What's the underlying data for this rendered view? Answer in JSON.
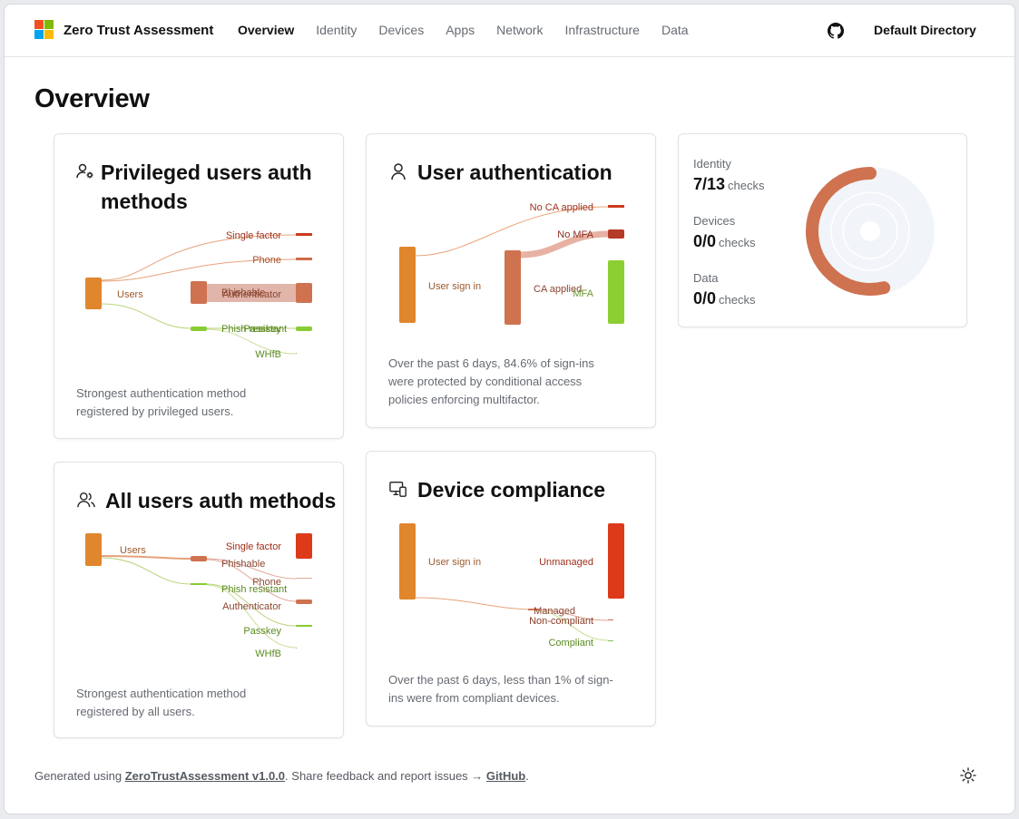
{
  "header": {
    "app_title": "Zero Trust Assessment",
    "nav": [
      "Overview",
      "Identity",
      "Devices",
      "Apps",
      "Network",
      "Infrastructure",
      "Data"
    ],
    "active_nav": "Overview",
    "tenant": "Default Directory",
    "logo_colors": [
      "#f25022",
      "#7fba00",
      "#00a4ef",
      "#ffb900"
    ]
  },
  "page_title": "Overview",
  "cards": {
    "privileged": {
      "title_line1": "Privileged users auth",
      "title_line2": "methods",
      "icon": "user-gear-icon",
      "desc_line1": "Strongest authentication method",
      "desc_line2": "registered by privileged users.",
      "labels": {
        "users": "Users",
        "single_factor": "Single factor",
        "phone": "Phone",
        "phishable": "Phishable",
        "authenticator": "Authenticator",
        "phish_resistant": "Phish resistant",
        "passkey": "Passkey",
        "whfb": "WHfB"
      }
    },
    "user_auth": {
      "title": "User authentication",
      "icon": "user-icon",
      "desc_line1": "Over the past 6 days, 84.6% of sign-ins",
      "desc_line2": "were protected by conditional access",
      "desc_line3": "policies enforcing multifactor.",
      "labels": {
        "no_ca": "No CA applied",
        "no_mfa": "No MFA",
        "sign_in": "User sign in",
        "ca_applied": "CA applied",
        "mfa": "MFA"
      }
    },
    "all_users": {
      "title": "All users auth methods",
      "icon": "users-icon",
      "desc_line1": "Strongest authentication method",
      "desc_line2": "registered by all users.",
      "labels": {
        "users": "Users",
        "single_factor": "Single factor",
        "phishable": "Phishable",
        "phone": "Phone",
        "phish_resistant": "Phish resistant",
        "authenticator": "Authenticator",
        "passkey": "Passkey",
        "whfb": "WHfB"
      }
    },
    "device": {
      "title": "Device compliance",
      "icon": "device-icon",
      "desc_line1": "Over the past 6 days, less than 1% of sign-",
      "desc_line2": "ins were from compliant devices.",
      "labels": {
        "sign_in": "User sign in",
        "unmanaged": "Unmanaged",
        "managed": "Managed",
        "non_compliant": "Non-compliant",
        "compliant": "Compliant"
      }
    },
    "summary": {
      "stats": [
        {
          "label": "Identity",
          "value": "7/13",
          "unit": "checks"
        },
        {
          "label": "Devices",
          "value": "0/0",
          "unit": "checks"
        },
        {
          "label": "Data",
          "value": "0/0",
          "unit": "checks"
        }
      ],
      "identity_fraction": 0.538,
      "ring_color": "#cf7250",
      "ring_track": "#f1f4f8"
    }
  },
  "footer": {
    "prefix": "Generated using ",
    "link1": "ZeroTrustAssessment v1.0.0",
    "middle": ". Share feedback and report issues → ",
    "link2": "GitHub",
    "suffix": "."
  }
}
